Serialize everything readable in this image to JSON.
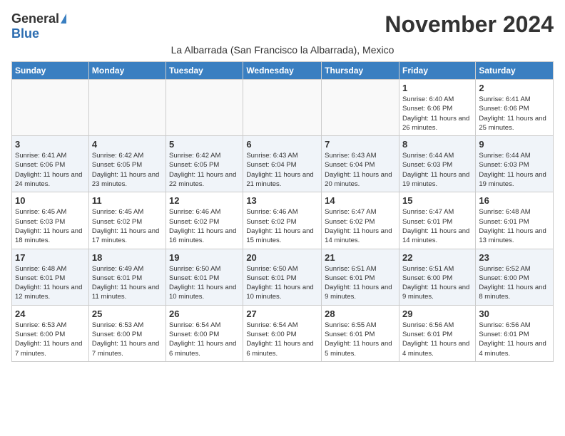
{
  "logo": {
    "general": "General",
    "blue": "Blue"
  },
  "title": "November 2024",
  "subtitle": "La Albarrada (San Francisco la Albarrada), Mexico",
  "days_of_week": [
    "Sunday",
    "Monday",
    "Tuesday",
    "Wednesday",
    "Thursday",
    "Friday",
    "Saturday"
  ],
  "weeks": [
    [
      {
        "day": "",
        "info": ""
      },
      {
        "day": "",
        "info": ""
      },
      {
        "day": "",
        "info": ""
      },
      {
        "day": "",
        "info": ""
      },
      {
        "day": "",
        "info": ""
      },
      {
        "day": "1",
        "info": "Sunrise: 6:40 AM\nSunset: 6:06 PM\nDaylight: 11 hours and 26 minutes."
      },
      {
        "day": "2",
        "info": "Sunrise: 6:41 AM\nSunset: 6:06 PM\nDaylight: 11 hours and 25 minutes."
      }
    ],
    [
      {
        "day": "3",
        "info": "Sunrise: 6:41 AM\nSunset: 6:06 PM\nDaylight: 11 hours and 24 minutes."
      },
      {
        "day": "4",
        "info": "Sunrise: 6:42 AM\nSunset: 6:05 PM\nDaylight: 11 hours and 23 minutes."
      },
      {
        "day": "5",
        "info": "Sunrise: 6:42 AM\nSunset: 6:05 PM\nDaylight: 11 hours and 22 minutes."
      },
      {
        "day": "6",
        "info": "Sunrise: 6:43 AM\nSunset: 6:04 PM\nDaylight: 11 hours and 21 minutes."
      },
      {
        "day": "7",
        "info": "Sunrise: 6:43 AM\nSunset: 6:04 PM\nDaylight: 11 hours and 20 minutes."
      },
      {
        "day": "8",
        "info": "Sunrise: 6:44 AM\nSunset: 6:03 PM\nDaylight: 11 hours and 19 minutes."
      },
      {
        "day": "9",
        "info": "Sunrise: 6:44 AM\nSunset: 6:03 PM\nDaylight: 11 hours and 19 minutes."
      }
    ],
    [
      {
        "day": "10",
        "info": "Sunrise: 6:45 AM\nSunset: 6:03 PM\nDaylight: 11 hours and 18 minutes."
      },
      {
        "day": "11",
        "info": "Sunrise: 6:45 AM\nSunset: 6:02 PM\nDaylight: 11 hours and 17 minutes."
      },
      {
        "day": "12",
        "info": "Sunrise: 6:46 AM\nSunset: 6:02 PM\nDaylight: 11 hours and 16 minutes."
      },
      {
        "day": "13",
        "info": "Sunrise: 6:46 AM\nSunset: 6:02 PM\nDaylight: 11 hours and 15 minutes."
      },
      {
        "day": "14",
        "info": "Sunrise: 6:47 AM\nSunset: 6:02 PM\nDaylight: 11 hours and 14 minutes."
      },
      {
        "day": "15",
        "info": "Sunrise: 6:47 AM\nSunset: 6:01 PM\nDaylight: 11 hours and 14 minutes."
      },
      {
        "day": "16",
        "info": "Sunrise: 6:48 AM\nSunset: 6:01 PM\nDaylight: 11 hours and 13 minutes."
      }
    ],
    [
      {
        "day": "17",
        "info": "Sunrise: 6:48 AM\nSunset: 6:01 PM\nDaylight: 11 hours and 12 minutes."
      },
      {
        "day": "18",
        "info": "Sunrise: 6:49 AM\nSunset: 6:01 PM\nDaylight: 11 hours and 11 minutes."
      },
      {
        "day": "19",
        "info": "Sunrise: 6:50 AM\nSunset: 6:01 PM\nDaylight: 11 hours and 10 minutes."
      },
      {
        "day": "20",
        "info": "Sunrise: 6:50 AM\nSunset: 6:01 PM\nDaylight: 11 hours and 10 minutes."
      },
      {
        "day": "21",
        "info": "Sunrise: 6:51 AM\nSunset: 6:01 PM\nDaylight: 11 hours and 9 minutes."
      },
      {
        "day": "22",
        "info": "Sunrise: 6:51 AM\nSunset: 6:00 PM\nDaylight: 11 hours and 9 minutes."
      },
      {
        "day": "23",
        "info": "Sunrise: 6:52 AM\nSunset: 6:00 PM\nDaylight: 11 hours and 8 minutes."
      }
    ],
    [
      {
        "day": "24",
        "info": "Sunrise: 6:53 AM\nSunset: 6:00 PM\nDaylight: 11 hours and 7 minutes."
      },
      {
        "day": "25",
        "info": "Sunrise: 6:53 AM\nSunset: 6:00 PM\nDaylight: 11 hours and 7 minutes."
      },
      {
        "day": "26",
        "info": "Sunrise: 6:54 AM\nSunset: 6:00 PM\nDaylight: 11 hours and 6 minutes."
      },
      {
        "day": "27",
        "info": "Sunrise: 6:54 AM\nSunset: 6:00 PM\nDaylight: 11 hours and 6 minutes."
      },
      {
        "day": "28",
        "info": "Sunrise: 6:55 AM\nSunset: 6:01 PM\nDaylight: 11 hours and 5 minutes."
      },
      {
        "day": "29",
        "info": "Sunrise: 6:56 AM\nSunset: 6:01 PM\nDaylight: 11 hours and 4 minutes."
      },
      {
        "day": "30",
        "info": "Sunrise: 6:56 AM\nSunset: 6:01 PM\nDaylight: 11 hours and 4 minutes."
      }
    ]
  ]
}
